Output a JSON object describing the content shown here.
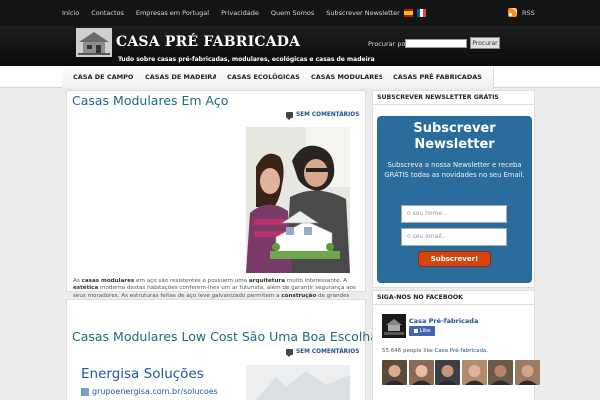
{
  "topnav": {
    "links": [
      "Início",
      "Contactos",
      "Empresas em Portugal",
      "Privacidade",
      "Quem Somos",
      "Subscrever Newsletter"
    ],
    "rss_label": "RSS"
  },
  "header": {
    "logo_text": "CASA PRÉ FABRICADA",
    "tagline": "Tudo sobre casas pré-fabricadas, modulares, ecológicas e casas de madeira",
    "search_label": "Procurar por:",
    "search_value": "",
    "search_button": "Procurar"
  },
  "menu": {
    "items": [
      "CASA DE CAMPO",
      "CASAS DE MADEIRA",
      "CASAS ECOLÓGICAS",
      "CASAS MODULARES",
      "CASAS PRÉ FABRICADAS"
    ]
  },
  "posts": [
    {
      "title": "Casas Modulares Em Aço",
      "comments": "SEM COMENTÁRIOS",
      "excerpt": {
        "p1": "As ",
        "b1": "casas modulares",
        "p2": " em aço são resistentes e possuem uma ",
        "b2": "arquitetura",
        "p3": " muito interessante. A ",
        "b3": "estética",
        "p4": " moderna destas habitações conferem-lhes um ar futurista, além de garantir segurança aos seus moradores. As estruturas feitas de aço leve galvanizado permitem a ",
        "b4": "construção",
        "p5": " de grandes edifícios de até seis andares, como hotéis e hospitais, assim como também ajudam na [...]"
      }
    },
    {
      "title": "Casas Modulares Low Cost São Uma Boa Escolha",
      "comments": "SEM COMENTÁRIOS",
      "ad_title": "Energisa Soluções",
      "ad_url": "grupoenergisa.com.br/solucoes"
    }
  ],
  "newsletter": {
    "widget_title": "SUBSCREVER NEWSLETTER GRÁTIS",
    "heading": "Subscrever Newsletter",
    "text": "Subscreva a nossa Newsletter e receba GRÁTIS todas as novidades no seu Email.",
    "name_placeholder": "o seu nome..",
    "email_placeholder": "o seu email..",
    "button": "Subscrever!",
    "button_color": "#d64510",
    "box_color": "#2a6c9c"
  },
  "facebook": {
    "widget_title": "SIGA-NOS NO FACEBOOK",
    "page_name": "Casa Pré-fabricada",
    "like_label": "Like",
    "fans_count": "55,646 people like ",
    "fans_page": "Casa Pré-fabricada."
  },
  "colors": {
    "link": "#1e6a80",
    "accent": "#1f4f8f"
  }
}
